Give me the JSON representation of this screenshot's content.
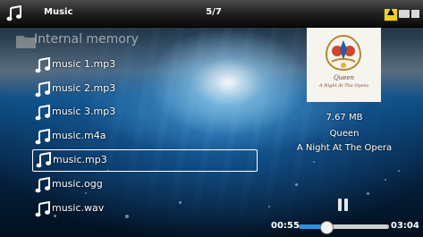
{
  "header": {
    "app_title": "Music",
    "counter": "5/7",
    "app_icon": "music-note-icon",
    "status_icons": [
      "warning-icon",
      "folder-icon",
      "battery-icon"
    ]
  },
  "browser": {
    "folder_label": "Internal memory",
    "files": [
      {
        "name": "music 1.mp3"
      },
      {
        "name": "music 2.mp3"
      },
      {
        "name": "music 3.mp3"
      },
      {
        "name": "music.m4a"
      },
      {
        "name": "music.mp3",
        "selected": true
      },
      {
        "name": "music.ogg"
      },
      {
        "name": "music.wav"
      }
    ]
  },
  "now_playing": {
    "album_art_text": "Queen",
    "album_art_subtext": "A Night At The Opera",
    "file_size": "7.67 MB",
    "artist": "Queen",
    "album": "A Night At The Opera",
    "elapsed": "00:55",
    "total": "03:04",
    "progress": 0.3
  },
  "colors": {
    "accent": "#2f8fe0",
    "selection_border": "#ffffff",
    "warning": "#f0d020"
  }
}
